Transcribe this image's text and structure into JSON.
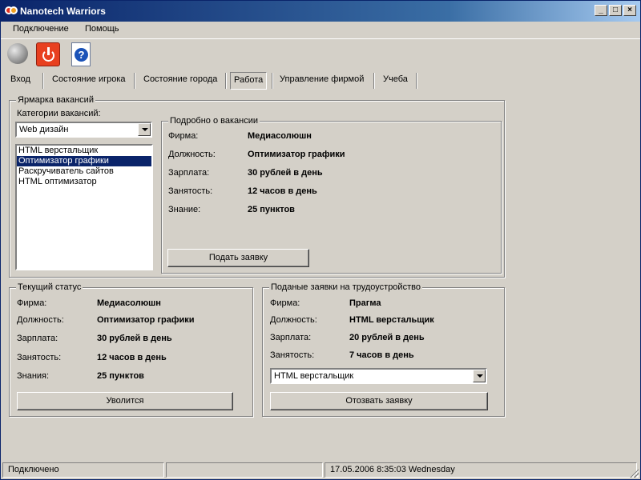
{
  "window": {
    "title": "Nanotech Warriors",
    "controls": {
      "minimize": "_",
      "maximize": "□",
      "close": "×"
    }
  },
  "menu": {
    "items": [
      "Подключение",
      "Помощь"
    ]
  },
  "toolbar": {
    "icons": [
      "globe-icon",
      "power-icon",
      "help-icon"
    ],
    "help_glyph": "?"
  },
  "tabs": [
    "Вход",
    "Состояние игрока",
    "Состояние города",
    "Работа",
    "Управление фирмой",
    "Учеба"
  ],
  "active_tab": "Работа",
  "job_fair": {
    "title": "Ярмарка вакансий",
    "categories_label": "Категории вакансий:",
    "category_selected": "Web дизайн",
    "vacancies": [
      "HTML верстальщик",
      "Оптимизатор графики",
      "Раскручиватель сайтов",
      "HTML оптимизатор"
    ],
    "selected_vacancy": "Оптимизатор графики",
    "details": {
      "title": "Подробно о вакансии",
      "firm_label": "Фирма:",
      "firm_value": "Медиасолюшн",
      "position_label": "Должность:",
      "position_value": "Оптимизатор графики",
      "salary_label": "Зарплата:",
      "salary_value": "30 рублей в день",
      "employment_label": "Занятость:",
      "employment_value": "12 часов в день",
      "knowledge_label": "Знание:",
      "knowledge_value": "25 пунктов",
      "apply_button": "Подать заявку"
    }
  },
  "current_status": {
    "title": "Текущий статус",
    "firm_label": "Фирма:",
    "firm_value": "Медиасолюшн",
    "position_label": "Должность:",
    "position_value": "Оптимизатор графики",
    "salary_label": "Зарплата:",
    "salary_value": "30 рублей в день",
    "employment_label": "Занятость:",
    "employment_value": "12 часов в день",
    "knowledge_label": "Знания:",
    "knowledge_value": "25 пунктов",
    "quit_button": "Уволится"
  },
  "applications": {
    "title": "Поданые заявки на трудоустройство",
    "firm_label": "Фирма:",
    "firm_value": "Прагма",
    "position_label": "Должность:",
    "position_value": "HTML верстальщик",
    "salary_label": "Зарплата:",
    "salary_value": "20 рублей в день",
    "employment_label": "Занятость:",
    "employment_value": "7 часов в день",
    "selected_application": "HTML верстальщик",
    "withdraw_button": "Отозвать заявку"
  },
  "status_bar": {
    "connection": "Подключено",
    "datetime": "17.05.2006 8:35:03  Wednesday"
  }
}
